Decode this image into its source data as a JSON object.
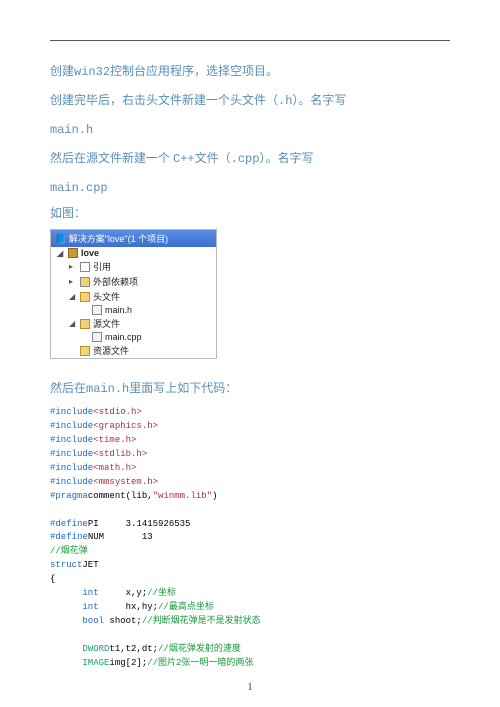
{
  "para1_a": "创建",
  "para1_b": "win32",
  "para1_c": "控制台应用程序，选择空项目。",
  "para2_a": "创建完毕后，右击头文件新建一个头文件（",
  "para2_b": ".h",
  "para2_c": "）。名字写",
  "para3": "main.h",
  "para4_a": "然后在源文件新建一个",
  "para4_b": "C++",
  "para4_c": "文件（",
  "para4_d": ".cpp",
  "para4_e": "）。名字写",
  "para5": "main.cpp",
  "para6": "如图：",
  "sol": {
    "title": "解决方案\"love\"(1 个项目)",
    "proj": "love",
    "ref": "引用",
    "extdep": "外部依赖项",
    "headers": "头文件",
    "mainh": "main.h",
    "sources": "源文件",
    "maincpp": "main.cpp",
    "res": "资源文件"
  },
  "sec2_a": "然后在",
  "sec2_b": "main.h",
  "sec2_c": "里面写上如下代码：",
  "code": {
    "inc1": "#include",
    "hdr1": "<stdio.h>",
    "inc2": "#include",
    "hdr2": "<graphics.h>",
    "inc3": "#include",
    "hdr3": "<time.h>",
    "inc4": "#include",
    "hdr4": "<stdlib.h>",
    "inc5": "#include",
    "hdr5": "<math.h>",
    "inc6": "#include",
    "hdr6": "<mmsystem.h>",
    "prag": "#pragma",
    "pragrest": "comment(",
    "praglib": "lib",
    "pragc1": ",",
    "pragstr": "\"winmm.lib\"",
    "pragend": ")",
    "defPI_a": "#define",
    "defPI_b": "PI",
    "defPI_c": "3.1415926535",
    "defNUM_a": "#define",
    "defNUM_b": "NUM",
    "defNUM_c": "13",
    "cm_fire": "//烟花弹",
    "struct": "struct",
    "structName": "JET",
    "lbrace": "{",
    "int1": "int",
    "int1v": "x,y;",
    "cm_xy": "//坐标",
    "int2": "int",
    "int2v": "hx,hy;",
    "cm_hxy": "//最高点坐标",
    "bool": "bool",
    "boolv": "shoot;",
    "cm_shoot": "//判断烟花弹是不是发射状态",
    "dword": "DWORD",
    "dwordv": "t1,t2,dt;",
    "cm_dw": "//烟花弹发射的速度",
    "image": "IMAGE",
    "imagev": "img[2];",
    "cm_img": "//图片2张一明一暗的两张"
  },
  "pagenum": "1"
}
